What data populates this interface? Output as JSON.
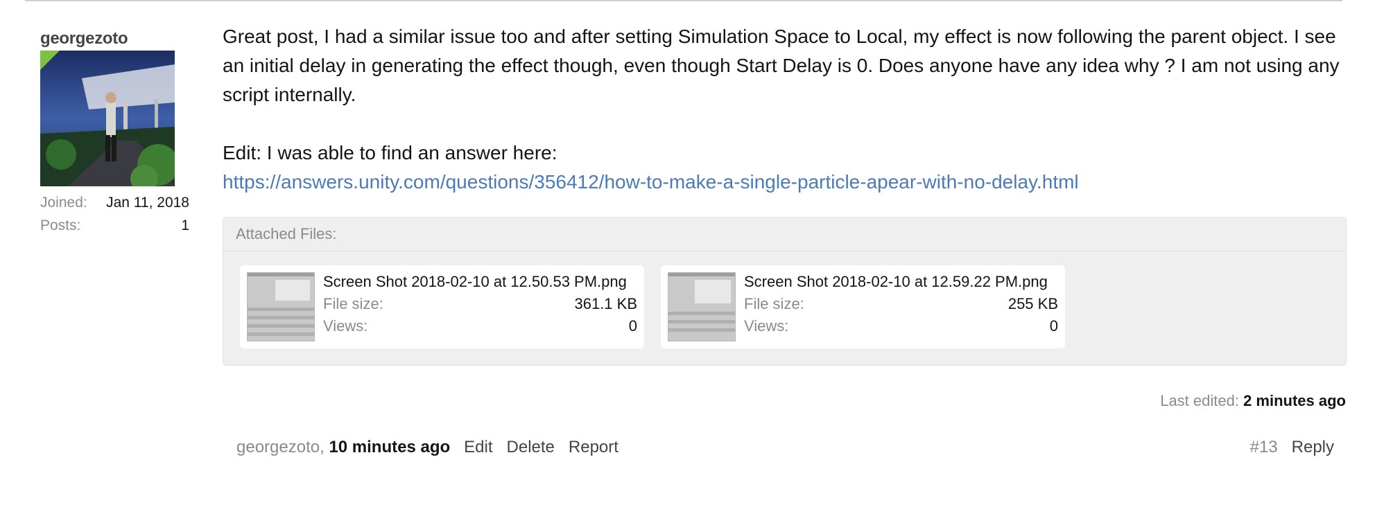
{
  "user": {
    "name": "georgezoto",
    "joined_label": "Joined:",
    "joined_value": "Jan 11, 2018",
    "posts_label": "Posts:",
    "posts_value": "1",
    "online_color": "#7cc242"
  },
  "message": {
    "paragraph1": "Great post, I had a similar issue too and after setting Simulation Space to Local, my effect is now following the parent object. I see an initial delay in generating the effect though, even though Start Delay is 0. Does anyone have any idea why ? I am not using any script internally.",
    "edit_text": "Edit: I was able to find an answer here:",
    "link": "https://answers.unity.com/questions/356412/how-to-make-a-single-particle-apear-with-no-delay.html",
    "link_color": "#4a7ab8"
  },
  "attachments": {
    "header": "Attached Files:",
    "files": [
      {
        "name": "Screen Shot 2018-02-10 at 12.50.53 PM.png",
        "size_label": "File size:",
        "size": "361.1 KB",
        "views_label": "Views:",
        "views": "0"
      },
      {
        "name": "Screen Shot 2018-02-10 at 12.59.22 PM.png",
        "size_label": "File size:",
        "size": "255 KB",
        "views_label": "Views:",
        "views": "0"
      }
    ]
  },
  "last_edited": {
    "label": "Last edited:",
    "value": "2 minutes ago"
  },
  "footer": {
    "author": "georgezoto,",
    "time": "10 minutes ago",
    "edit": "Edit",
    "delete": "Delete",
    "report": "Report",
    "post_number": "#13",
    "reply": "Reply"
  }
}
